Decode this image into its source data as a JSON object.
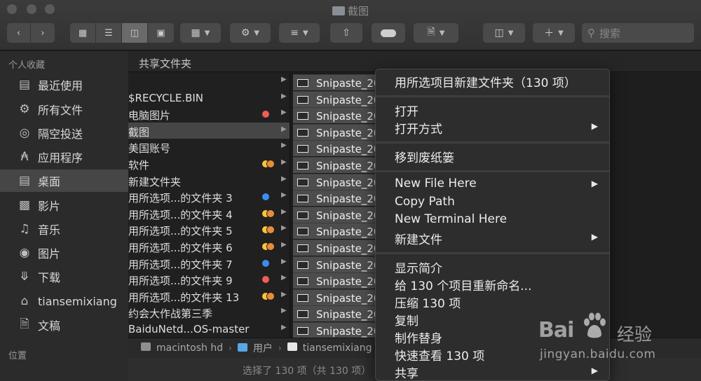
{
  "window": {
    "title": "截图"
  },
  "toolbar": {
    "search_placeholder": "搜索"
  },
  "sidebar": {
    "favorites_header": "个人收藏",
    "items": [
      {
        "label": "最近使用",
        "icon": "recents-icon"
      },
      {
        "label": "所有文件",
        "icon": "gear-icon"
      },
      {
        "label": "隔空投送",
        "icon": "airdrop-icon"
      },
      {
        "label": "应用程序",
        "icon": "applications-icon"
      },
      {
        "label": "桌面",
        "icon": "desktop-icon"
      },
      {
        "label": "影片",
        "icon": "movies-icon"
      },
      {
        "label": "音乐",
        "icon": "music-icon"
      },
      {
        "label": "图片",
        "icon": "camera-icon"
      },
      {
        "label": "下载",
        "icon": "download-icon"
      },
      {
        "label": "tiansemixiang",
        "icon": "home-icon"
      },
      {
        "label": "文稿",
        "icon": "documents-icon"
      }
    ],
    "locations_header": "位置"
  },
  "path_header": "共享文件夹",
  "column1": [
    {
      "label": "",
      "tags": []
    },
    {
      "label": "$RECYCLE.BIN",
      "tags": []
    },
    {
      "label": "电脑图片",
      "tags": [
        "#ef5d55"
      ]
    },
    {
      "label": "截图",
      "tags": []
    },
    {
      "label": "美国账号",
      "tags": []
    },
    {
      "label": "软件",
      "tags": [
        "#f7c53b",
        "#e98c3a"
      ]
    },
    {
      "label": "新建文件夹",
      "tags": []
    },
    {
      "label": "用所选项...的文件夹 3",
      "tags": [
        "#3d8bf0"
      ]
    },
    {
      "label": "用所选项...的文件夹 4",
      "tags": [
        "#f7c53b",
        "#e98c3a"
      ]
    },
    {
      "label": "用所选项...的文件夹 5",
      "tags": [
        "#f7c53b",
        "#e98c3a"
      ]
    },
    {
      "label": "用所选项...的文件夹 6",
      "tags": [
        "#f7c53b",
        "#e98c3a"
      ]
    },
    {
      "label": "用所选项...的文件夹 7",
      "tags": [
        "#3d8bf0"
      ]
    },
    {
      "label": "用所选项...的文件夹 9",
      "tags": [
        "#ef5d55"
      ]
    },
    {
      "label": "用所选项...的文件夹 13",
      "tags": [
        "#f7c53b",
        "#e98c3a"
      ]
    },
    {
      "label": "约会大作战第三季",
      "tags": []
    },
    {
      "label": "BaiduNetd...OS-master",
      "tags": []
    }
  ],
  "column1_selected_index": 3,
  "column2": [
    "Snipaste_20",
    "Snipaste_20",
    "Snipaste_20",
    "Snipaste_20",
    "Snipaste_20",
    "Snipaste_20",
    "Snipaste_20",
    "Snipaste_20",
    "Snipaste_20",
    "Snipaste_20",
    "Snipaste_20",
    "Snipaste_20",
    "Snipaste_20",
    "Snipaste_20",
    "Snipaste_20",
    "Snipaste_20"
  ],
  "pathbar": {
    "segments": [
      {
        "label": "macintosh hd",
        "color": "#8f8f8f"
      },
      {
        "label": "用户",
        "color": "#5aa7e6"
      },
      {
        "label": "tiansemixiang",
        "color": "#e7e7e7"
      }
    ]
  },
  "status": "选择了 130 项（共 130 项）",
  "context_menu": {
    "groups": [
      [
        {
          "label": "用所选项目新建文件夹（130 项）",
          "submenu": false
        }
      ],
      [
        {
          "label": "打开",
          "submenu": false
        },
        {
          "label": "打开方式",
          "submenu": true
        }
      ],
      [
        {
          "label": "移到废纸篓",
          "submenu": false
        }
      ],
      [
        {
          "label": "New File Here",
          "submenu": true
        },
        {
          "label": "Copy Path",
          "submenu": false
        },
        {
          "label": "New Terminal Here",
          "submenu": false
        },
        {
          "label": "新建文件",
          "submenu": true
        }
      ],
      [
        {
          "label": "显示简介",
          "submenu": false
        },
        {
          "label": "给 130 个项目重新命名...",
          "submenu": false
        },
        {
          "label": "压缩 130 项",
          "submenu": false
        },
        {
          "label": "复制",
          "submenu": false
        },
        {
          "label": "制作替身",
          "submenu": false
        },
        {
          "label": "快速查看 130 项",
          "submenu": false
        },
        {
          "label": "共享",
          "submenu": true
        }
      ]
    ]
  },
  "watermark": {
    "brand_left": "Bai",
    "brand_right": "经验",
    "url": "jingyan.baidu.com"
  }
}
